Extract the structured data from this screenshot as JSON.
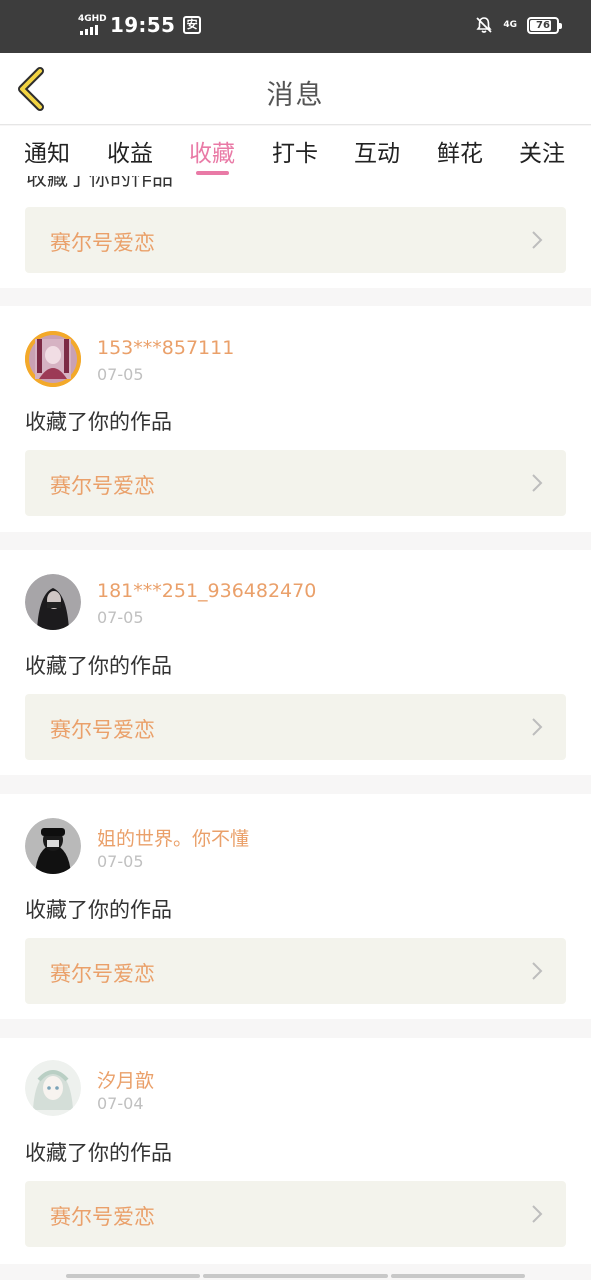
{
  "status_bar": {
    "network_left": "4GHD",
    "time": "19:55",
    "app_icon": "安",
    "network_right": "4G",
    "battery": "76"
  },
  "header": {
    "title": "消息",
    "back_icon": "chevron-left-icon"
  },
  "tabs": [
    {
      "label": "通知",
      "active": false
    },
    {
      "label": "收益",
      "active": false
    },
    {
      "label": "收藏",
      "active": true
    },
    {
      "label": "打卡",
      "active": false
    },
    {
      "label": "互动",
      "active": false
    },
    {
      "label": "鲜花",
      "active": false
    },
    {
      "label": "关注",
      "active": false
    }
  ],
  "colors": {
    "accent": "#e97aa6",
    "name": "#eaa06a",
    "work_bg": "#f3f3ec"
  },
  "items": [
    {
      "action": "收藏了你的作品",
      "work": "赛尔号爱恋"
    },
    {
      "user": "153***857111",
      "date": "07-05",
      "action": "收藏了你的作品",
      "work": "赛尔号爱恋"
    },
    {
      "user": "181***251_936482470",
      "date": "07-05",
      "action": "收藏了你的作品",
      "work": "赛尔号爱恋"
    },
    {
      "user": "姐的世界。你不懂",
      "date": "07-05",
      "action": "收藏了你的作品",
      "work": "赛尔号爱恋"
    },
    {
      "user": "汐月歆",
      "date": "07-04",
      "action": "收藏了你的作品",
      "work": "赛尔号爱恋"
    }
  ]
}
